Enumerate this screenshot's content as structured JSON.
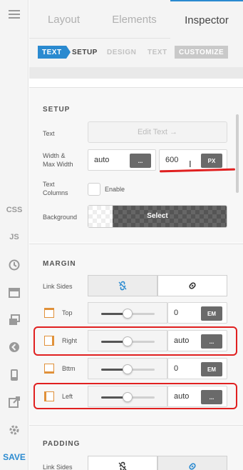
{
  "rail": {
    "items": [
      {
        "name": "menu-icon",
        "label": ""
      },
      {
        "name": "css-button",
        "label": "CSS"
      },
      {
        "name": "js-button",
        "label": "JS"
      },
      {
        "name": "history-icon",
        "label": ""
      },
      {
        "name": "window-icon",
        "label": ""
      },
      {
        "name": "layers-icon",
        "label": ""
      },
      {
        "name": "collapse-icon",
        "label": ""
      },
      {
        "name": "mobile-icon",
        "label": ""
      },
      {
        "name": "external-link-icon",
        "label": ""
      },
      {
        "name": "gear-icon",
        "label": ""
      }
    ],
    "save_label": "SAVE"
  },
  "tabs": {
    "layout": "Layout",
    "elements": "Elements",
    "inspector": "Inspector"
  },
  "subtabs": {
    "text": "TEXT",
    "setup": "SETUP",
    "design": "DESIGN",
    "text2": "TEXT",
    "customize": "CUSTOMIZE"
  },
  "setup": {
    "title": "SETUP",
    "text_label": "Text",
    "edit_text_button": "Edit Text →",
    "width_label_1": "Width &",
    "width_label_2": "Max Width",
    "width_value": "auto",
    "width_unit": "...",
    "max_width_value": "600",
    "max_width_unit": "PX",
    "text_columns_label_1": "Text",
    "text_columns_label_2": "Columns",
    "enable_label": "Enable",
    "background_label": "Background",
    "background_select": "Select"
  },
  "margin": {
    "title": "MARGIN",
    "link_sides_label": "Link Sides",
    "rows": [
      {
        "side": "Top",
        "value": "0",
        "unit": "EM"
      },
      {
        "side": "Right",
        "value": "auto",
        "unit": "..."
      },
      {
        "side": "Bttm",
        "value": "0",
        "unit": "EM"
      },
      {
        "side": "Left",
        "value": "auto",
        "unit": "..."
      }
    ]
  },
  "padding": {
    "title": "PADDING",
    "link_sides_label": "Link Sides"
  },
  "colors": {
    "accent": "#2a8ad0",
    "side_icon": "#e0913a",
    "annotation": "#e02020"
  }
}
